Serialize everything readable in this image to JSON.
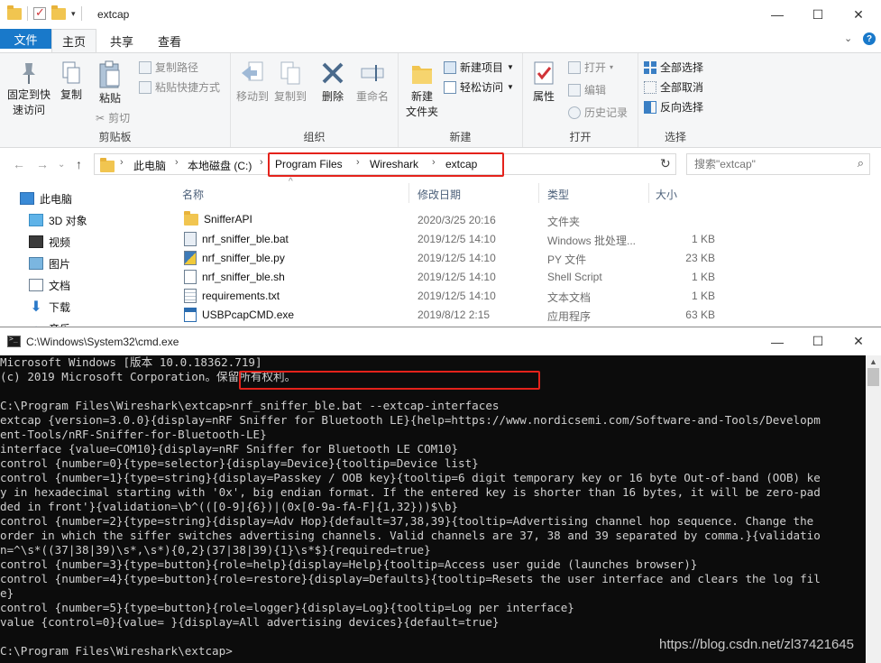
{
  "explorer": {
    "title": "extcap",
    "window_controls": {
      "minimize": "—",
      "maximize": "☐",
      "close": "✕"
    },
    "tabs": {
      "file": "文件",
      "home": "主页",
      "share": "共享",
      "view": "查看"
    },
    "ribbon": {
      "clipboard": {
        "label": "剪贴板",
        "pin": "固定到快\n速访问",
        "copy": "复制",
        "paste": "粘贴",
        "copy_path": "复制路径",
        "paste_shortcut": "粘贴快捷方式",
        "cut": "剪切"
      },
      "organize": {
        "label": "组织",
        "move_to": "移动到",
        "copy_to": "复制到",
        "delete": "删除",
        "rename": "重命名"
      },
      "new": {
        "label": "新建",
        "new_folder": "新建\n文件夹",
        "new_item": "新建项目",
        "easy_access": "轻松访问"
      },
      "open": {
        "label": "打开",
        "properties": "属性",
        "open": "打开",
        "edit": "编辑",
        "history": "历史记录"
      },
      "select": {
        "label": "选择",
        "select_all": "全部选择",
        "select_none": "全部取消",
        "invert": "反向选择"
      }
    },
    "address": {
      "crumbs": [
        "此电脑",
        "本地磁盘 (C:)",
        "Program Files",
        "Wireshark",
        "extcap"
      ],
      "search_placeholder": "搜索\"extcap\""
    },
    "nav_pane": [
      {
        "label": "此电脑",
        "icon": "computer-icon"
      },
      {
        "label": "3D 对象",
        "icon": "cube-icon"
      },
      {
        "label": "视频",
        "icon": "video-icon"
      },
      {
        "label": "图片",
        "icon": "picture-icon"
      },
      {
        "label": "文档",
        "icon": "document-icon"
      },
      {
        "label": "下载",
        "icon": "download-icon"
      },
      {
        "label": "音乐",
        "icon": "music-icon"
      }
    ],
    "columns": {
      "name": "名称",
      "date": "修改日期",
      "type": "类型",
      "size": "大小"
    },
    "files": [
      {
        "name": "SnifferAPI",
        "date": "2020/3/25 20:16",
        "type": "文件夹",
        "size": "",
        "icon": "folder-icon"
      },
      {
        "name": "nrf_sniffer_ble.bat",
        "date": "2019/12/5 14:10",
        "type": "Windows 批处理...",
        "size": "1 KB",
        "icon": "batch-file-icon"
      },
      {
        "name": "nrf_sniffer_ble.py",
        "date": "2019/12/5 14:10",
        "type": "PY 文件",
        "size": "23 KB",
        "icon": "python-file-icon"
      },
      {
        "name": "nrf_sniffer_ble.sh",
        "date": "2019/12/5 14:10",
        "type": "Shell Script",
        "size": "1 KB",
        "icon": "shell-file-icon"
      },
      {
        "name": "requirements.txt",
        "date": "2019/12/5 14:10",
        "type": "文本文档",
        "size": "1 KB",
        "icon": "text-file-icon"
      },
      {
        "name": "USBPcapCMD.exe",
        "date": "2019/8/12 2:15",
        "type": "应用程序",
        "size": "63 KB",
        "icon": "exe-file-icon"
      }
    ],
    "colors": {
      "accent": "#1979ca",
      "highlight": "#e4221b",
      "folder": "#f1c550"
    }
  },
  "cmd": {
    "title": "C:\\Windows\\System32\\cmd.exe",
    "lines": [
      "Microsoft Windows [版本 10.0.18362.719]",
      "(c) 2019 Microsoft Corporation。保留所有权利。",
      "",
      "C:\\Program Files\\Wireshark\\extcap>nrf_sniffer_ble.bat --extcap-interfaces",
      "extcap {version=3.0.0}{display=nRF Sniffer for Bluetooth LE}{help=https://www.nordicsemi.com/Software-and-Tools/Developm",
      "ent-Tools/nRF-Sniffer-for-Bluetooth-LE}",
      "interface {value=COM10}{display=nRF Sniffer for Bluetooth LE COM10}",
      "control {number=0}{type=selector}{display=Device}{tooltip=Device list}",
      "control {number=1}{type=string}{display=Passkey / OOB key}{tooltip=6 digit temporary key or 16 byte Out-of-band (OOB) ke",
      "y in hexadecimal starting with '0x', big endian format. If the entered key is shorter than 16 bytes, it will be zero-pad",
      "ded in front'}{validation=\\b^(([0-9]{6})|(0x[0-9a-fA-F]{1,32}))$\\b}",
      "control {number=2}{type=string}{display=Adv Hop}{default=37,38,39}{tooltip=Advertising channel hop sequence. Change the",
      "order in which the siffer switches advertising channels. Valid channels are 37, 38 and 39 separated by comma.}{validatio",
      "n=^\\s*((37|38|39)\\s*,\\s*){0,2}(37|38|39){1}\\s*$}{required=true}",
      "control {number=3}{type=button}{role=help}{display=Help}{tooltip=Access user guide (launches browser)}",
      "control {number=4}{type=button}{role=restore}{display=Defaults}{tooltip=Resets the user interface and clears the log fil",
      "e}",
      "control {number=5}{type=button}{role=logger}{display=Log}{tooltip=Log per interface}",
      "value {control=0}{value= }{display=All advertising devices}{default=true}",
      "",
      "C:\\Program Files\\Wireshark\\extcap>"
    ]
  },
  "watermark": "https://blog.csdn.net/zl37421645"
}
